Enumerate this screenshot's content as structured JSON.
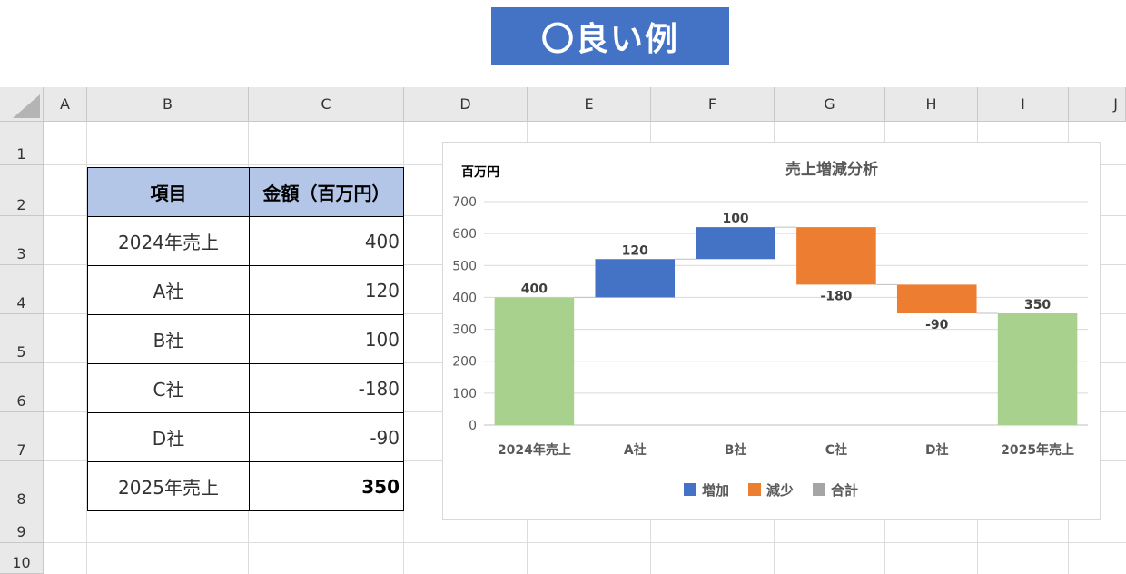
{
  "banner": {
    "text": "〇良い例"
  },
  "columns": [
    "A",
    "B",
    "C",
    "D",
    "E",
    "F",
    "G",
    "H",
    "I",
    "J"
  ],
  "rows": [
    "1",
    "2",
    "3",
    "4",
    "5",
    "6",
    "7",
    "8",
    "9",
    "10"
  ],
  "table": {
    "headers": [
      "項目",
      "金額（百万円）"
    ],
    "rows": [
      {
        "item": "2024年売上",
        "amount": "400"
      },
      {
        "item": "A社",
        "amount": "120"
      },
      {
        "item": "B社",
        "amount": "100"
      },
      {
        "item": "C社",
        "amount": "-180"
      },
      {
        "item": "D社",
        "amount": "-90"
      },
      {
        "item": "2025年売上",
        "amount": "350"
      }
    ]
  },
  "colors": {
    "increase": "#4472c4",
    "decrease": "#ed7d31",
    "total": "#a9d18e",
    "legend_total": "#a5a5a5"
  },
  "chart_data": {
    "type": "bar",
    "subtype": "waterfall",
    "title": "売上増減分析",
    "ylabel": "百万円",
    "categories": [
      "2024年売上",
      "A社",
      "B社",
      "C社",
      "D社",
      "2025年売上"
    ],
    "values": [
      400,
      120,
      100,
      -180,
      -90,
      350
    ],
    "kinds": [
      "total",
      "increase",
      "increase",
      "decrease",
      "decrease",
      "total"
    ],
    "data_labels": [
      "400",
      "120",
      "100",
      "-180",
      "-90",
      "350"
    ],
    "yticks": [
      "0",
      "100",
      "200",
      "300",
      "400",
      "500",
      "600",
      "700"
    ],
    "ylim": [
      0,
      700
    ],
    "grid": true,
    "legend": {
      "position": "bottom",
      "entries": [
        "増加",
        "減少",
        "合計"
      ]
    }
  }
}
